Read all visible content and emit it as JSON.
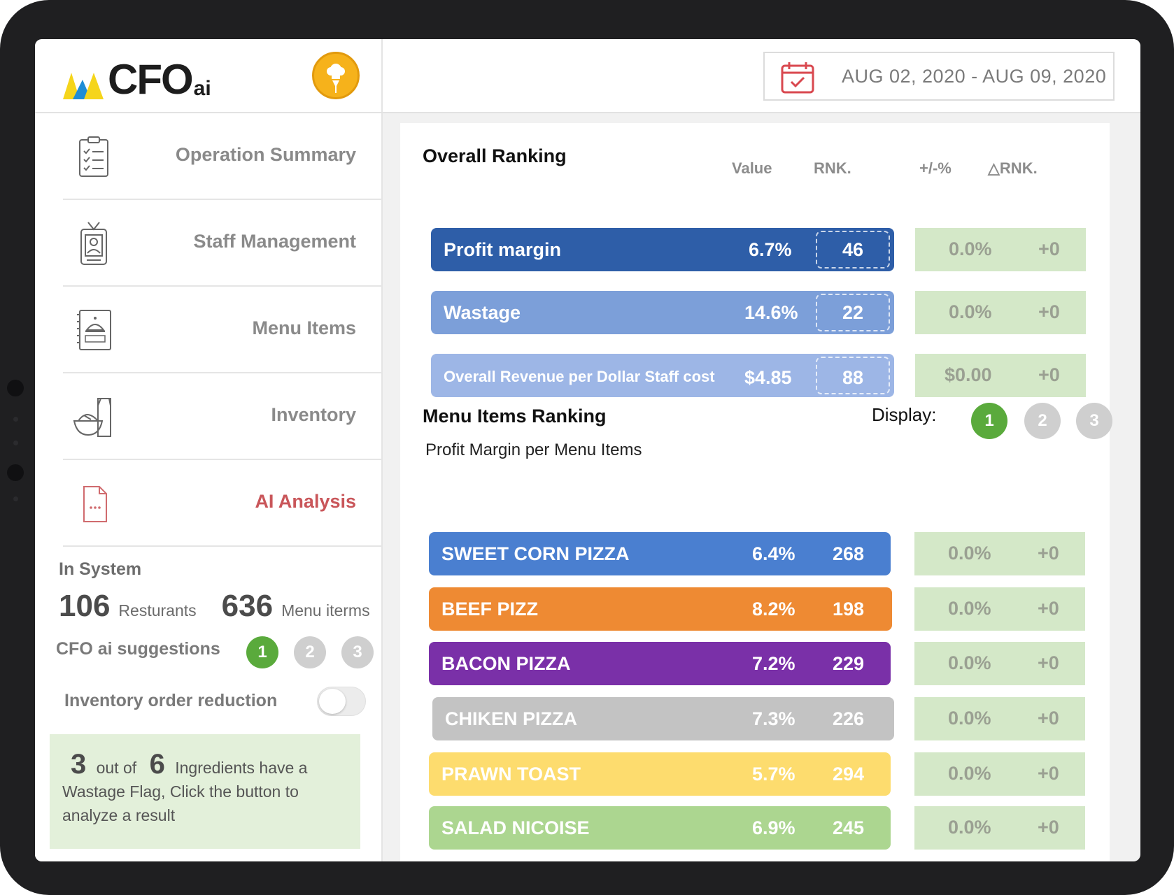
{
  "app": {
    "logo_text": "CFO",
    "logo_sub": "ai"
  },
  "sidebar": {
    "items": [
      {
        "label": "Operation Summary",
        "icon": "clipboard-icon"
      },
      {
        "label": "Staff Management",
        "icon": "id-badge-icon"
      },
      {
        "label": "Menu Items",
        "icon": "menu-book-icon"
      },
      {
        "label": "Inventory",
        "icon": "groceries-icon"
      },
      {
        "label": "AI Analysis",
        "icon": "document-dots-icon",
        "active": true
      }
    ],
    "in_system_label": "In System",
    "restaurants_count": "106",
    "restaurants_label": "Resturants",
    "menu_items_count": "636",
    "menu_items_label": "Menu iterms",
    "suggestions_label": "CFO ai suggestions",
    "suggestion_pages": [
      "1",
      "2",
      "3"
    ],
    "inventory_toggle_label": "Inventory order reduction",
    "inventory_toggle_on": false,
    "flag": {
      "count": "3",
      "out_of": "out of",
      "total": "6",
      "text_a": "Ingredients have a",
      "text_b": "Wastage Flag, Click the button to",
      "text_c": "analyze  a result"
    }
  },
  "header": {
    "date_range": "AUG 02, 2020 - AUG 09, 2020"
  },
  "overall": {
    "title": "Overall Ranking",
    "col_value": "Value",
    "col_rank": "RNK.",
    "col_change": "+/-%",
    "col_delta_rank": "△RNK.",
    "rows": [
      {
        "label": "Profit margin",
        "value": "6.7%",
        "rank": "46",
        "change": "0.0%",
        "delta": "+0",
        "color": "#2e5ea8"
      },
      {
        "label": "Wastage",
        "value": "14.6%",
        "rank": "22",
        "change": "0.0%",
        "delta": "+0",
        "color": "#7c9fd9"
      },
      {
        "label": "Overall Revenue per Dollar Staff cost",
        "value": "$4.85",
        "rank": "88",
        "change": "$0.00",
        "delta": "+0",
        "color": "#9db6e6"
      }
    ]
  },
  "menu": {
    "title": "Menu Items Ranking",
    "subtitle": "Profit Margin per Menu Items",
    "display_label": "Display:",
    "display_pages": [
      "1",
      "2",
      "3"
    ],
    "rows": [
      {
        "label": "SWEET CORN PIZZA",
        "value": "6.4%",
        "rank": "268",
        "change": "0.0%",
        "delta": "+0",
        "color": "#4a7fd0"
      },
      {
        "label": "BEEF PIZZ",
        "value": "8.2%",
        "rank": "198",
        "change": "0.0%",
        "delta": "+0",
        "color": "#ee8a33"
      },
      {
        "label": "BACON PIZZA",
        "value": "7.2%",
        "rank": "229",
        "change": "0.0%",
        "delta": "+0",
        "color": "#7a30a8"
      },
      {
        "label": "CHIKEN PIZZA",
        "value": "7.3%",
        "rank": "226",
        "change": "0.0%",
        "delta": "+0",
        "color": "#c3c3c3"
      },
      {
        "label": "PRAWN TOAST",
        "value": "5.7%",
        "rank": "294",
        "change": "0.0%",
        "delta": "+0",
        "color": "#fddc6e"
      },
      {
        "label": "SALAD NICOISE",
        "value": "6.9%",
        "rank": "245",
        "change": "0.0%",
        "delta": "+0",
        "color": "#acd690"
      }
    ]
  }
}
